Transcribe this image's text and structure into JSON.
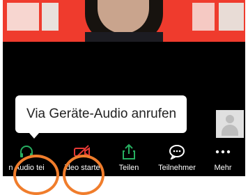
{
  "tooltip": {
    "text": "Via Geräte-Audio anrufen"
  },
  "toolbar": {
    "items": [
      {
        "label": "n Audio tei",
        "icon": "headphones-icon"
      },
      {
        "label": "ideo starte",
        "icon": "video-off-icon"
      },
      {
        "label": "Teilen",
        "icon": "share-icon"
      },
      {
        "label": "Teilnehmer",
        "icon": "chat-icon"
      },
      {
        "label": "Mehr",
        "icon": "more-icon"
      }
    ]
  },
  "colors": {
    "toolbar_bg": "#000000",
    "highlight_circle": "#f07d2c",
    "video_accent": "#ef3b2d",
    "share_green": "#27ae60",
    "video_off_red": "#e53935"
  }
}
